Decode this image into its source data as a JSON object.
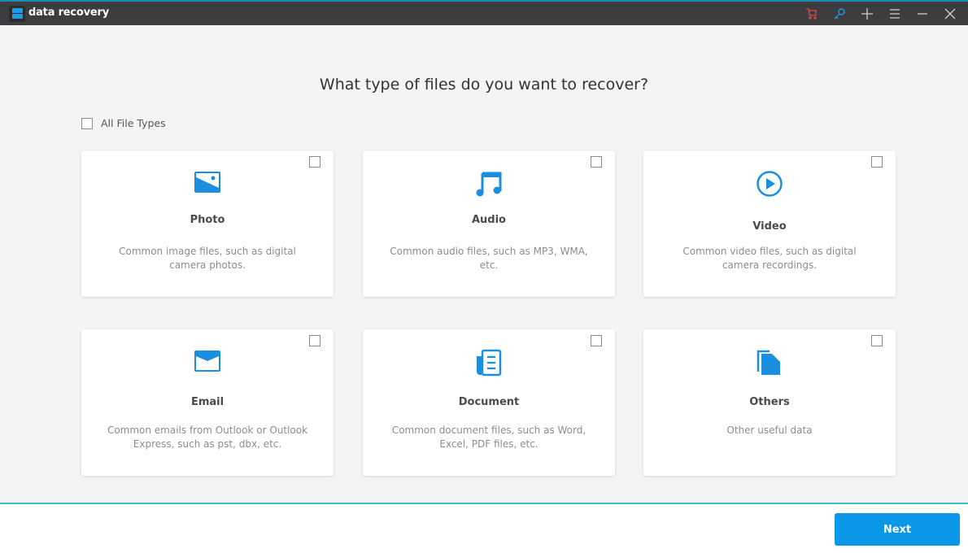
{
  "window": {
    "app_title": "data recovery",
    "controls": [
      {
        "name": "cart-icon",
        "color": "#e04a4a"
      },
      {
        "name": "key-icon",
        "color": "#1c9be6"
      },
      {
        "name": "plus-icon",
        "color": "#cfcfcf"
      },
      {
        "name": "menu-icon",
        "color": "#cfcfcf"
      },
      {
        "name": "minimize-icon",
        "color": "#cfcfcf"
      },
      {
        "name": "close-icon",
        "color": "#cfcfcf"
      }
    ]
  },
  "main": {
    "heading": "What type of files do you want to recover?",
    "all_file_types": {
      "label": "All File Types",
      "checked": false
    },
    "cards": [
      {
        "title": "Photo",
        "desc": "Common image files, such as digital camera photos.",
        "icon": "photo-icon",
        "checked": false
      },
      {
        "title": "Audio",
        "desc": "Common audio files, such as MP3, WMA, etc.",
        "icon": "music-note-icon",
        "checked": false
      },
      {
        "title": "Video",
        "desc": "Common video files, such as digital camera recordings.",
        "icon": "play-circle-icon",
        "checked": false
      },
      {
        "title": "Email",
        "desc": "Common emails from Outlook or Outlook Express, such as pst, dbx, etc.",
        "icon": "envelope-icon",
        "checked": false
      },
      {
        "title": "Document",
        "desc": "Common document files, such as Word, Excel, PDF files, etc.",
        "icon": "document-icon",
        "checked": false
      },
      {
        "title": "Others",
        "desc": "Other useful data",
        "icon": "files-icon",
        "checked": false
      }
    ]
  },
  "footer": {
    "next_label": "Next"
  },
  "colors": {
    "accent": "#0b97e8",
    "icon": "#1a8fe0",
    "titlebar": "#3d3d3f",
    "footer_line": "#44b9d4"
  }
}
